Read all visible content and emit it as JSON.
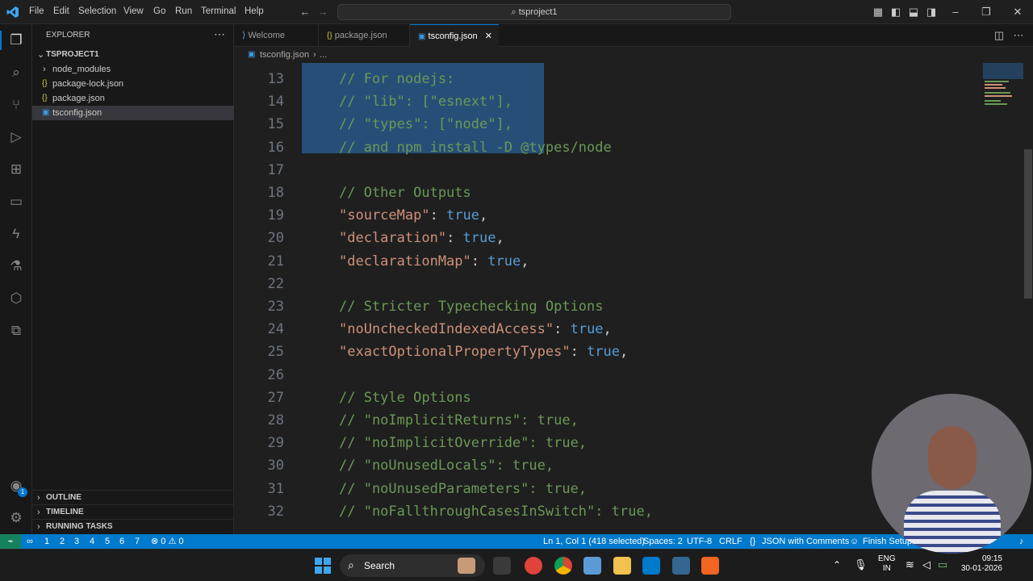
{
  "menu": [
    "File",
    "Edit",
    "Selection",
    "View",
    "Go",
    "Run",
    "Terminal",
    "Help"
  ],
  "search": {
    "text": "tsproject1"
  },
  "explorer": {
    "title": "EXPLORER",
    "project": "TSPROJECT1",
    "items": [
      "node_modules",
      "package-lock.json",
      "package.json",
      "tsconfig.json"
    ],
    "outline": "OUTLINE",
    "timeline": "TIMELINE",
    "running_tasks": "RUNNING TASKS"
  },
  "tabs": [
    {
      "label": "Welcome"
    },
    {
      "label": "package.json"
    },
    {
      "label": "tsconfig.json"
    }
  ],
  "breadcrumb": {
    "file": "tsconfig.json",
    "sep": "›",
    "rest": "..."
  },
  "code": [
    {
      "n": "13",
      "t": "// For nodejs:",
      "c": "cm"
    },
    {
      "n": "14",
      "t": "// \"lib\": [\"esnext\"],",
      "c": "cm"
    },
    {
      "n": "15",
      "t": "// \"types\": [\"node\"],",
      "c": "cm"
    },
    {
      "n": "16",
      "t": "// and npm install -D @types/node",
      "c": "cm"
    },
    {
      "n": "17",
      "t": "",
      "c": "cm"
    },
    {
      "n": "18",
      "t": "// Other Outputs",
      "c": "cm"
    },
    {
      "n": "19",
      "k": "\"sourceMap\"",
      "v": "true",
      "c": "kv"
    },
    {
      "n": "20",
      "k": "\"declaration\"",
      "v": "true",
      "c": "kv"
    },
    {
      "n": "21",
      "k": "\"declarationMap\"",
      "v": "true",
      "c": "kv"
    },
    {
      "n": "22",
      "t": "",
      "c": "cm"
    },
    {
      "n": "23",
      "t": "// Stricter Typechecking Options",
      "c": "cm"
    },
    {
      "n": "24",
      "k": "\"noUncheckedIndexedAccess\"",
      "v": "true",
      "c": "kv"
    },
    {
      "n": "25",
      "k": "\"exactOptionalPropertyTypes\"",
      "v": "true",
      "c": "kv"
    },
    {
      "n": "26",
      "t": "",
      "c": "cm"
    },
    {
      "n": "27",
      "t": "// Style Options",
      "c": "cm"
    },
    {
      "n": "28",
      "t": "// \"noImplicitReturns\": true,",
      "c": "cm"
    },
    {
      "n": "29",
      "t": "// \"noImplicitOverride\": true,",
      "c": "cm"
    },
    {
      "n": "30",
      "t": "// \"noUnusedLocals\": true,",
      "c": "cm"
    },
    {
      "n": "31",
      "t": "// \"noUnusedParameters\": true,",
      "c": "cm"
    },
    {
      "n": "32",
      "t": "// \"noFallthroughCasesInSwitch\": true,",
      "c": "cm"
    }
  ],
  "status": {
    "remote": "⌁",
    "infinity": "∞",
    "numbers": [
      "1",
      "2",
      "3",
      "4",
      "5",
      "6",
      "7"
    ],
    "problems": "⊗ 0 ⚠ 0",
    "position": "Ln 1, Col 1 (418 selected)",
    "spaces": "Spaces: 2",
    "encoding": "UTF-8",
    "eol": "CRLF",
    "language": "JSON with Comments",
    "setup": "Finish Setup"
  },
  "taskbar": {
    "search": "Search",
    "lang1": "ENG",
    "lang2": "IN",
    "time": "09:15",
    "date": "30-01-2026"
  },
  "badge": "1",
  "colors": {
    "accent": "#007acc",
    "selection": "#264f78",
    "comment": "#6a9955",
    "string": "#ce9178",
    "keyword": "#569cd6"
  }
}
